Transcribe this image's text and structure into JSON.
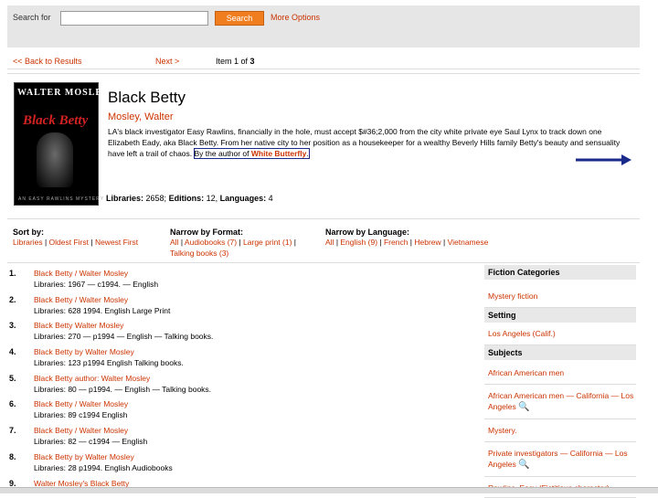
{
  "search": {
    "label": "Search for",
    "value": "",
    "button": "Search",
    "more_options": "More Options"
  },
  "nav": {
    "back": "<< Back to Results",
    "next": "Next >",
    "item_prefix": "Item 1 of ",
    "item_total": "3"
  },
  "book": {
    "cover_author": "WALTER MOSLEY",
    "cover_title": "Black Betty",
    "cover_sub": "AN EASY RAWLINS MYSTERY",
    "title": "Black Betty",
    "author": "Mosley, Walter",
    "desc_main": "LA's black investigator Easy Rawlins, financially in the hole, must accept $#36;2,000 from the city white private eye Saul Lynx to track down one Elizabeth Eady, aka Black Betty. From her native city to her position as a housekeeper for a wealthy Beverly Hills family Betty's beauty and sensuality have left a trail of chaos.",
    "desc_by": "By the author of",
    "desc_link": "White Butterfly",
    "stats_libraries_label": "Libraries:",
    "stats_libraries": "2658;",
    "stats_editions_label": "Editions:",
    "stats_editions": "12,",
    "stats_languages_label": "Languages:",
    "stats_languages": "4"
  },
  "facets": {
    "sort": {
      "title": "Sort by:",
      "items": [
        "Libraries",
        "Oldest First",
        "Newest First"
      ]
    },
    "format": {
      "title": "Narrow by Format:",
      "items": [
        "All",
        "Audiobooks (7)",
        "Large print (1)",
        "Talking books (3)"
      ]
    },
    "language": {
      "title": "Narrow by Language:",
      "items": [
        "All",
        "English (9)",
        "French",
        "Hebrew",
        "Vietnamese"
      ]
    }
  },
  "results": [
    {
      "num": "1.",
      "title": "Black Betty / Walter Mosley",
      "meta": "Libraries: 1967 — c1994. — English"
    },
    {
      "num": "2.",
      "title": "Black Betty / Walter Mosley",
      "meta": "Libraries: 628   1994.   English    Large Print"
    },
    {
      "num": "3.",
      "title": "Black Betty Walter Mosley",
      "meta": "Libraries: 270 — p1994 — English — Talking books."
    },
    {
      "num": "4.",
      "title": "Black Betty by Walter Mosley",
      "meta": "Libraries: 123   p1994   English   Talking books."
    },
    {
      "num": "5.",
      "title": "Black Betty author: Walter Mosley",
      "meta": "Libraries: 80 — p1994. — English — Talking books."
    },
    {
      "num": "6.",
      "title": "Black Betty / Walter Mosley",
      "meta": "Libraries: 89   c1994   English"
    },
    {
      "num": "7.",
      "title": "Black Betty / Walter Mosley",
      "meta": "Libraries: 82 — c1994 — English"
    },
    {
      "num": "8.",
      "title": "Black Betty by Walter Mosley",
      "meta": "Libraries: 28   p1994.   English   Audiobooks"
    },
    {
      "num": "9.",
      "title": "Walter Mosley's Black Betty",
      "meta": ""
    }
  ],
  "sidebar": {
    "fiction_head": "Fiction Categories",
    "fiction_item": "Mystery fiction",
    "setting_head": "Setting",
    "setting_item": "Los Angeles (Calif.)",
    "subjects_head": "Subjects",
    "subjects": [
      "African American men",
      "African American men — California — Los Angeles",
      "Mystery.",
      "Private investigators — California — Los Angeles",
      "Rawlins, Easy (Fictitious character)"
    ]
  }
}
